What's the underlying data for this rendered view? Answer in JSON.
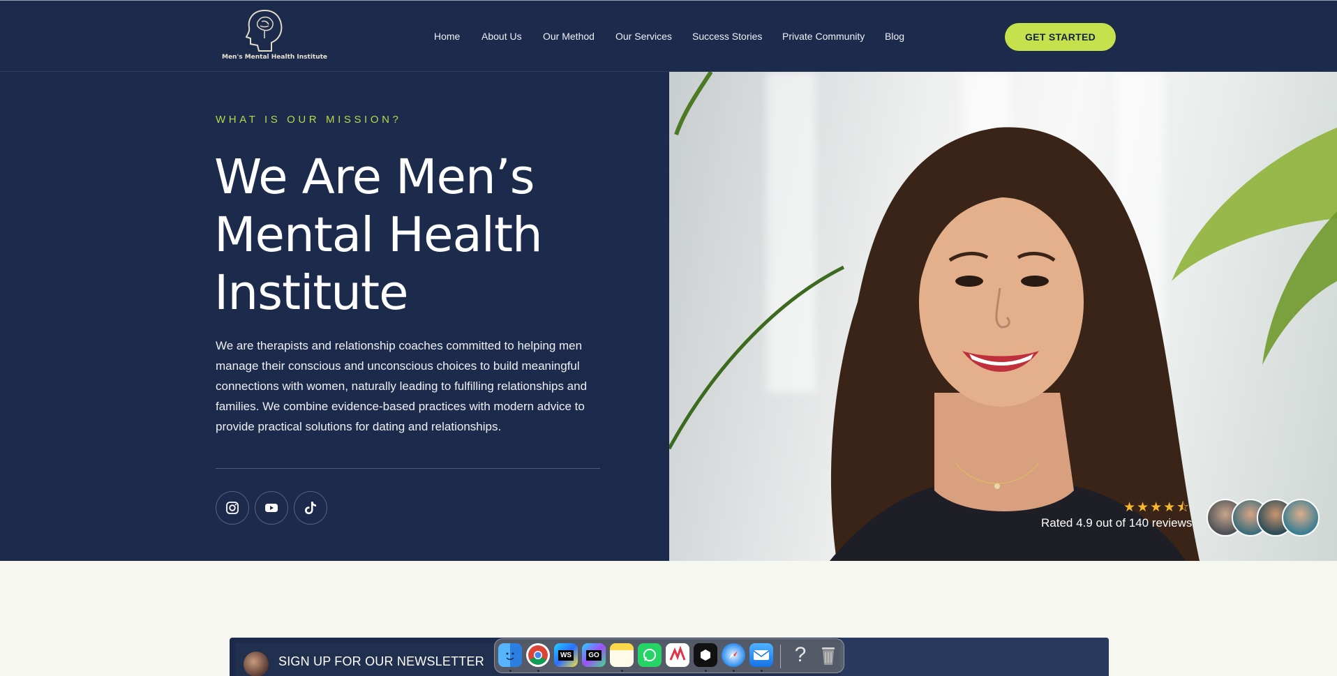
{
  "header": {
    "logo_text": "Men's Mental Health Institute",
    "nav": [
      "Home",
      "About Us",
      "Our Method",
      "Our Services",
      "Success Stories",
      "Private Community",
      "Blog"
    ],
    "cta_label": "GET STARTED"
  },
  "hero": {
    "eyebrow": "WHAT IS OUR MISSION?",
    "title_lines": [
      "We Are Men’s",
      "Mental Health",
      "Institute"
    ],
    "description": "We are therapists and relationship coaches committed to helping men manage their conscious and unconscious choices to build meaningful connections with women, naturally leading to fulfilling relationships and families. We combine evidence-based practices with modern advice to provide practical solutions for dating and relationships.",
    "social_icons": [
      "instagram-icon",
      "youtube-icon",
      "tiktok-icon"
    ],
    "rating": {
      "stars": "★★★★⯪",
      "text": "Rated 4.9 out of 140 reviews"
    }
  },
  "newsletter": {
    "label": "SIGN UP FOR OUR NEWSLETTER"
  },
  "dock": {
    "apps": [
      "finder-icon",
      "chrome-icon",
      "webstorm-icon",
      "goland-icon",
      "notes-icon",
      "whatsapp-icon",
      "app-icon",
      "app-icon-dark",
      "safari-icon",
      "mail-icon",
      "help-icon",
      "trash-icon"
    ],
    "labels": {
      "webstorm": "WS",
      "goland": "GO",
      "help": "?"
    }
  },
  "colors": {
    "navy": "#1c2a4b",
    "accent": "#c5e24d",
    "eyebrow": "#b8d84a",
    "stars": "#f5b82e"
  }
}
